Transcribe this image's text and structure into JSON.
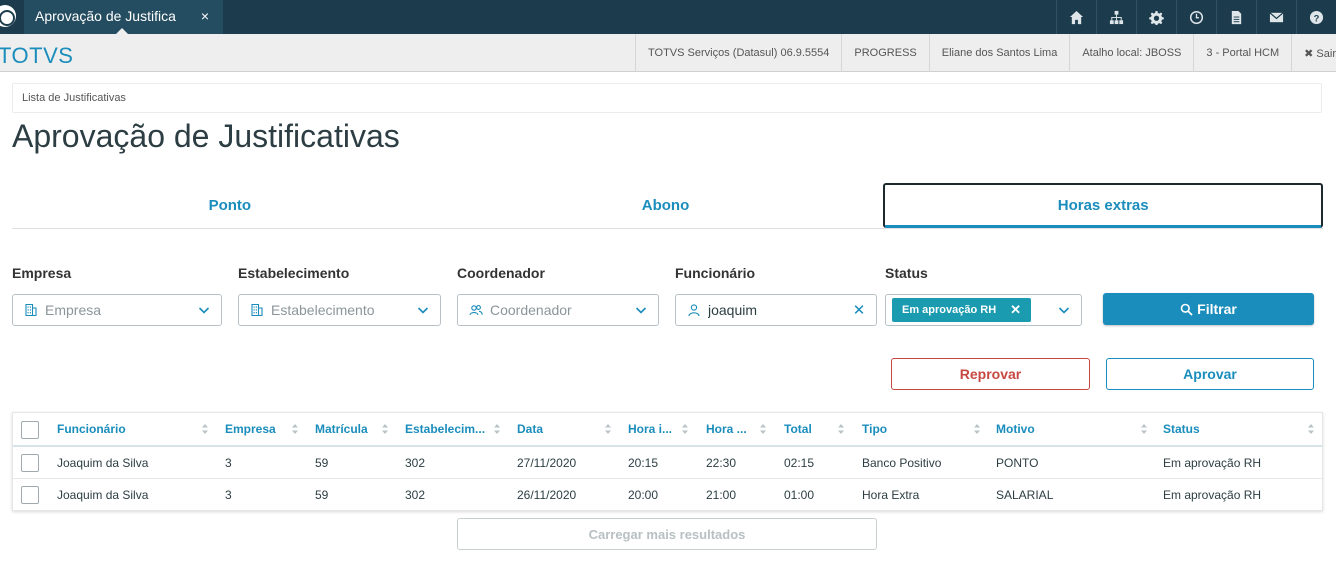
{
  "window": {
    "tab_title": "Aprovação de Justifica",
    "tab_close": "×"
  },
  "topbar_icons": [
    "home-icon",
    "sitemap-icon",
    "gear-icon",
    "clock-icon",
    "document-icon",
    "mail-icon",
    "help-icon"
  ],
  "header": {
    "brand": "TOTVS",
    "items": [
      "TOTVS Serviços (Datasul) 06.9.5554",
      "PROGRESS",
      "Eliane dos Santos Lima",
      "Atalho local: JBOSS",
      "3 - Portal HCM"
    ],
    "logout": "✖ Sair"
  },
  "breadcrumb": "Lista de Justificativas",
  "page_title": "Aprovação de Justificativas",
  "tabs": [
    {
      "label": "Ponto",
      "selected": false
    },
    {
      "label": "Abono",
      "selected": false
    },
    {
      "label": "Horas extras",
      "selected": true
    }
  ],
  "filters": {
    "empresa": {
      "label": "Empresa",
      "placeholder": "Empresa"
    },
    "estabelecimento": {
      "label": "Estabelecimento",
      "placeholder": "Estabelecimento"
    },
    "coordenador": {
      "label": "Coordenador",
      "placeholder": "Coordenador"
    },
    "funcionario": {
      "label": "Funcionário",
      "value": "joaquim"
    },
    "status": {
      "label": "Status",
      "chip": "Em aprovação RH"
    }
  },
  "actions": {
    "filter": "Filtrar",
    "reject": "Reprovar",
    "approve": "Aprovar",
    "load_more": "Carregar mais resultados"
  },
  "table": {
    "columns": [
      "Funcionário",
      "Empresa",
      "Matrícula",
      "Estabelecim...",
      "Data",
      "Hora i...",
      "Hora ...",
      "Total",
      "Tipo",
      "Motivo",
      "Status"
    ],
    "rows": [
      [
        "Joaquim da Silva",
        "3",
        "59",
        "302",
        "27/11/2020",
        "20:15",
        "22:30",
        "02:15",
        "Banco Positivo",
        "PONTO",
        "Em aprovação RH"
      ],
      [
        "Joaquim da Silva",
        "3",
        "59",
        "302",
        "26/11/2020",
        "20:00",
        "21:00",
        "01:00",
        "Hora Extra",
        "SALARIAL",
        "Em aprovação RH"
      ]
    ]
  },
  "colors": {
    "primary": "#1a8dbc",
    "topbar": "#1c3c4d",
    "danger": "#c64840",
    "chip": "#1a9bb0"
  }
}
